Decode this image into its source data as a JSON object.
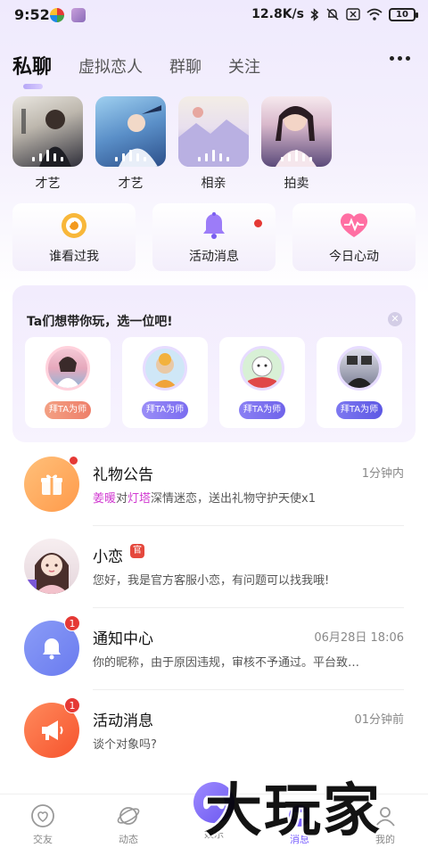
{
  "status_bar": {
    "time": "9:52",
    "net_speed": "12.8K/s",
    "battery": "10",
    "icons": [
      "bluetooth-icon",
      "mute-icon",
      "sim-x-icon",
      "wifi-icon",
      "battery-icon"
    ]
  },
  "tabs": [
    {
      "label": "私聊",
      "active": true
    },
    {
      "label": "虚拟恋人",
      "active": false
    },
    {
      "label": "群聊",
      "active": false
    },
    {
      "label": "关注",
      "active": false
    }
  ],
  "live_rooms": [
    {
      "label": "才艺",
      "thumb_color": "#3b3b46"
    },
    {
      "label": "才艺",
      "thumb_color": "#6ea3d6"
    },
    {
      "label": "相亲",
      "thumb_color": "#c9c0e8"
    },
    {
      "label": "拍卖",
      "thumb_color": "#6e5a8c"
    }
  ],
  "features": [
    {
      "label": "谁看过我",
      "icon": "eye-icon",
      "color": "#f5a623"
    },
    {
      "label": "活动消息",
      "icon": "bell-icon",
      "color": "#9b7bf7",
      "dot": true
    },
    {
      "label": "今日心动",
      "icon": "heart-pulse-icon",
      "color": "#ff5a9a"
    }
  ],
  "mentor": {
    "title": "Ta们想带你玩，选一位吧!",
    "button_label": "拜TA为师",
    "close_icon": "close-icon",
    "cards": [
      {
        "button_color": "#f08a70"
      },
      {
        "button_color": "#8a7cf5"
      },
      {
        "button_color": "#7a6cf0"
      },
      {
        "button_color": "#6a64ea"
      }
    ]
  },
  "messages": [
    {
      "title": "礼物公告",
      "time": "1分钟内",
      "preview_parts": {
        "name1": "姜暖",
        "mid1": "对",
        "name2": "灯塔",
        "rest": "深情迷恋，送出礼物守护天使x1"
      },
      "icon": "gift-icon",
      "color": "#ffab5c",
      "dot": true
    },
    {
      "title": "小恋",
      "time": "",
      "preview": "您好，我是官方客服小恋，有问题可以找我哦!",
      "badge_label": "官",
      "icon": "avatar"
    },
    {
      "title": "通知中心",
      "time": "06月28日 18:06",
      "preview": "你的昵称，由于原因违规，审核不予通过。平台致…",
      "icon": "bell-icon",
      "color": "#7a8bf5",
      "count": "1"
    },
    {
      "title": "活动消息",
      "time": "01分钟前",
      "preview": "谈个对象吗?",
      "icon": "megaphone-icon",
      "color": "#ff6a3d",
      "count": "1"
    }
  ],
  "bottom_nav": [
    {
      "label": "交友",
      "icon": "heart-circle-icon",
      "active": false
    },
    {
      "label": "动态",
      "icon": "planet-icon",
      "active": false
    },
    {
      "label": "娱乐",
      "icon": "game-icon",
      "active": false
    },
    {
      "label": "消息",
      "icon": "message-icon",
      "active": true
    },
    {
      "label": "我的",
      "icon": "profile-icon",
      "active": false
    }
  ],
  "watermark": "大玩家"
}
